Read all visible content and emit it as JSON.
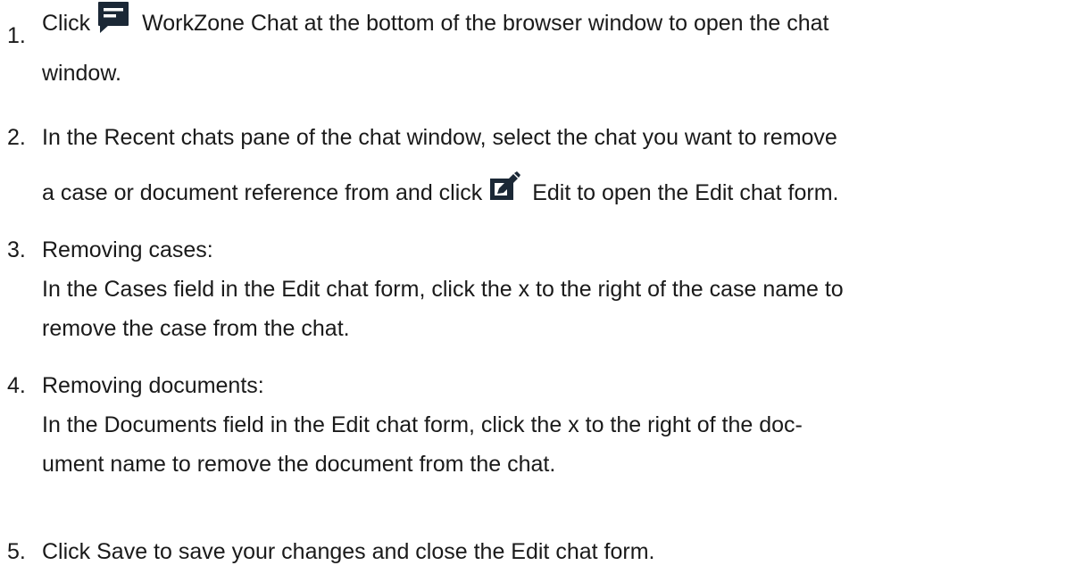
{
  "steps": [
    {
      "number": "1.",
      "line1": {
        "a": "Click",
        "icon": "chat-icon",
        "b": "WorkZone Chat",
        "c": " at the bottom of the browser window to open the chat"
      },
      "line2": "window."
    },
    {
      "number": "2.",
      "line1": {
        "a": "In the ",
        "b": "Recent chats",
        "c": " pane of the chat window, select the chat you want to remove"
      },
      "line2": {
        "a": "a case or document reference from and click ",
        "icon": "edit-icon",
        "b": "Edit",
        "c": " to open the ",
        "d": "Edit chat",
        "e": " form."
      }
    },
    {
      "number": "3.",
      "heading": "Removing cases:",
      "line1": {
        "a": "In the ",
        "b": "Cases",
        "c": " field in the ",
        "d": "Edit chat",
        "e": " form, click the ",
        "f": "x",
        "g": " to the right of the case name to"
      },
      "line2": "remove the case from the chat."
    },
    {
      "number": "4.",
      "heading": "Removing documents:",
      "line1": {
        "a": "In the ",
        "b": "Documents",
        "c": " field in the ",
        "d": "Edit chat",
        "e": " form, click the ",
        "f": "x",
        "g": " to the right of the doc-"
      },
      "line2": "ument name to remove the document from the chat."
    },
    {
      "number": "5.",
      "line1": {
        "a": "Click ",
        "b": "Save",
        "c": " to save your changes and close the ",
        "d": "Edit chat",
        "e": " form."
      }
    }
  ],
  "colors": {
    "text": "#1a1a1a",
    "icon": "#1a2a3a"
  }
}
